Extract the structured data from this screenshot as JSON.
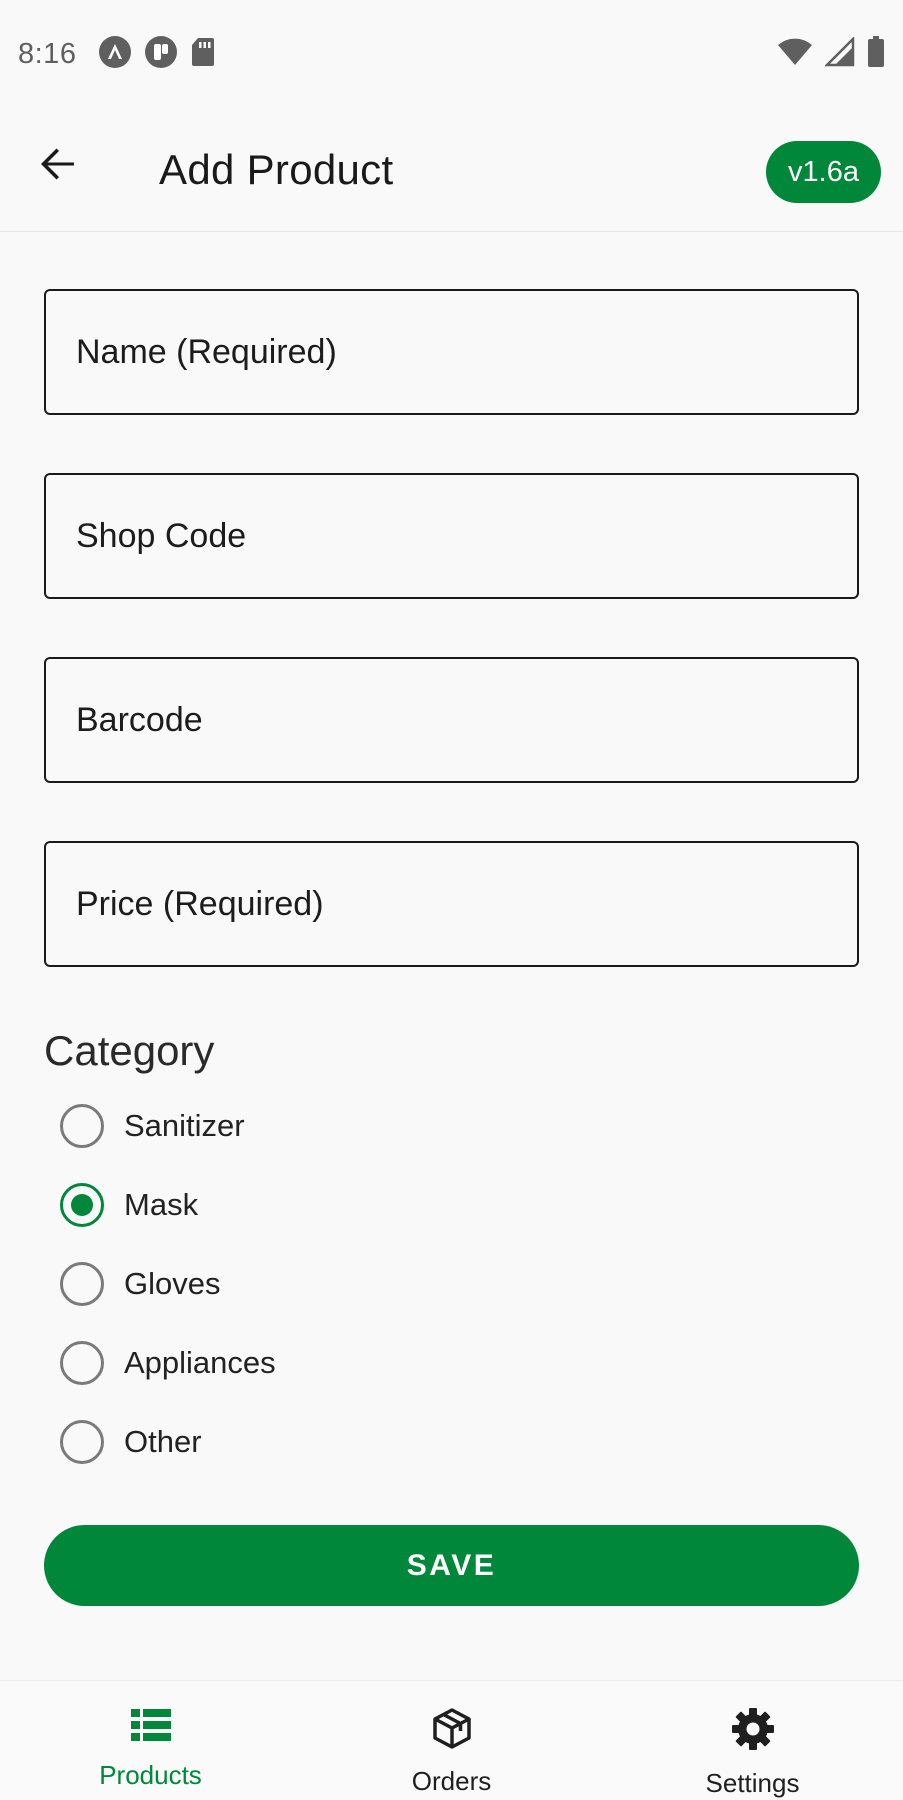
{
  "status_bar": {
    "time": "8:16",
    "left_icons": [
      "autopilot-icon",
      "app-notification-icon",
      "sd-card-icon"
    ],
    "right_icons": [
      "wifi-icon",
      "cell-signal-icon",
      "battery-icon"
    ]
  },
  "app_bar": {
    "back_icon": "arrow-back-icon",
    "title": "Add Product",
    "version": "v1.6a"
  },
  "form": {
    "name_placeholder": "Name (Required)",
    "shop_code_placeholder": "Shop Code",
    "barcode_placeholder": "Barcode",
    "price_placeholder": "Price (Required)"
  },
  "category": {
    "title": "Category",
    "options": [
      {
        "label": "Sanitizer",
        "selected": false
      },
      {
        "label": "Mask",
        "selected": true
      },
      {
        "label": "Gloves",
        "selected": false
      },
      {
        "label": "Appliances",
        "selected": false
      },
      {
        "label": "Other",
        "selected": false
      }
    ]
  },
  "save_label": "SAVE",
  "bottom_nav": {
    "items": [
      {
        "label": "Products",
        "icon": "list-icon",
        "active": true
      },
      {
        "label": "Orders",
        "icon": "box-icon",
        "active": false
      },
      {
        "label": "Settings",
        "icon": "gear-icon",
        "active": false
      }
    ]
  },
  "colors": {
    "accent": "#00873a",
    "background": "#f9f9f9",
    "text": "#1c1c1c"
  }
}
